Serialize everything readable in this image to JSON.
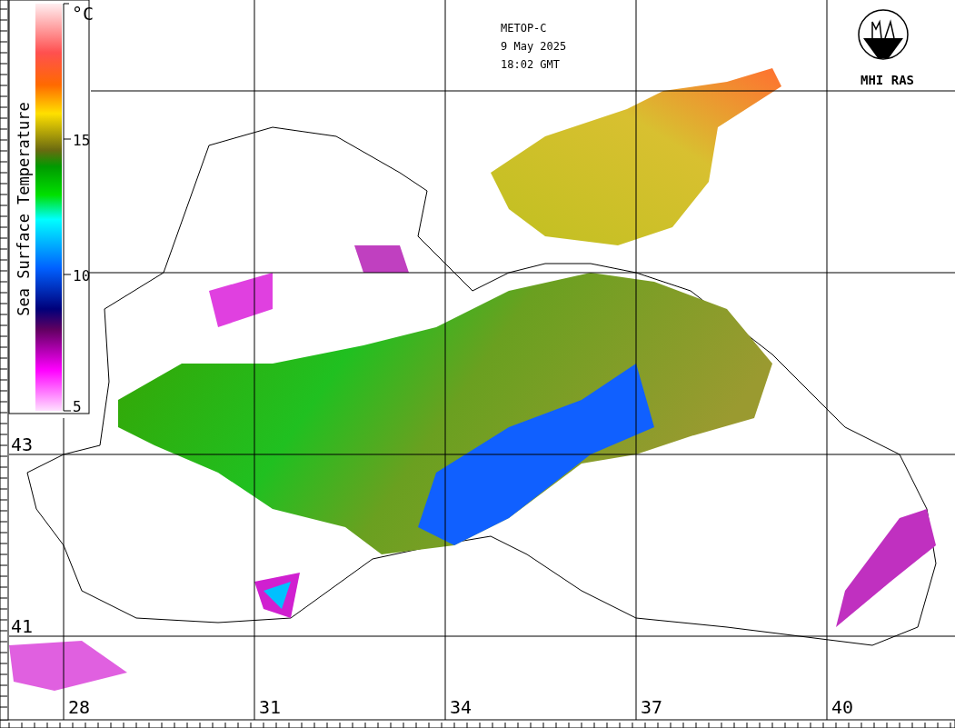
{
  "header": {
    "satellite": "METOP-C",
    "date": "9 May 2025",
    "time": "18:02 GMT"
  },
  "logo": {
    "text": "MHI RAS"
  },
  "legend": {
    "title": "Sea Surface Temperature",
    "unit": "°C",
    "ticks": [
      "15",
      "10",
      "5"
    ]
  },
  "map": {
    "latitude_labels": [
      "43",
      "41"
    ],
    "longitude_labels": [
      "28",
      "31",
      "34",
      "37",
      "40"
    ]
  }
}
